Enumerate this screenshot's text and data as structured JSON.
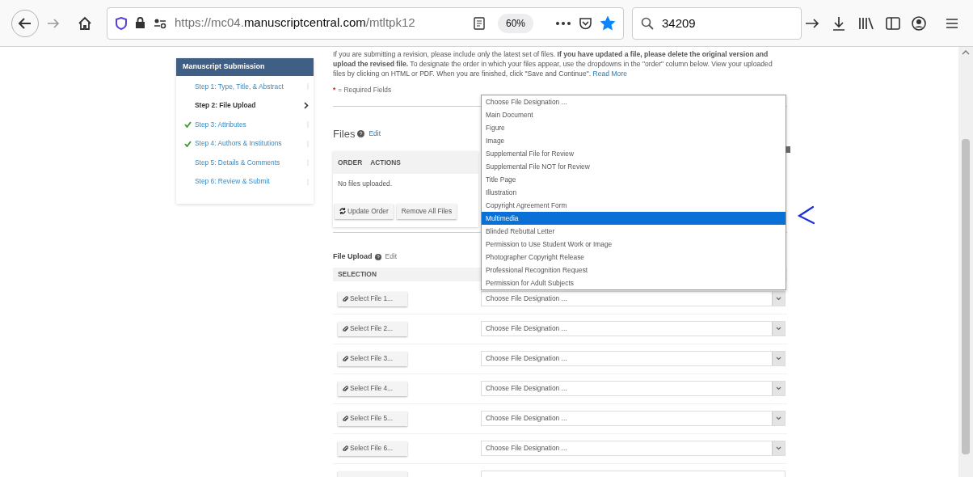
{
  "browser": {
    "url": {
      "prefix": "https://mc04.",
      "domain": "manuscriptcentral.com",
      "path": "/mtltpk12"
    },
    "zoom": "60%",
    "bookmarked": true,
    "search": "34209"
  },
  "sidebar": {
    "title": "Manuscript Submission",
    "steps": [
      {
        "label": "Step 1: Type, Title, & Abstract",
        "done": false,
        "selected": false
      },
      {
        "label": "Step 2: File Upload",
        "done": false,
        "selected": true
      },
      {
        "label": "Step 3: Attributes",
        "done": true,
        "selected": false
      },
      {
        "label": "Step 4: Authors & Institutions",
        "done": true,
        "selected": false
      },
      {
        "label": "Step 5: Details & Comments",
        "done": false,
        "selected": false
      },
      {
        "label": "Step 6: Review & Submit",
        "done": false,
        "selected": false
      }
    ]
  },
  "intro": "If you are submitting a revision, please include only the latest set of files. **If you have updated a file, please delete the original version and upload the revised file.** To designate the order in which your files appear, use the dropdowns in the \"order\" column below. View your uploaded files by clicking on HTML or PDF. When you are finished, click \"Save and Continue\".",
  "read_more": "Read More",
  "required": {
    "mark": "*",
    "label": "= Required Fields"
  },
  "files": {
    "title": "Files",
    "edit": "Edit",
    "columns": [
      "ORDER",
      "ACTIONS"
    ],
    "empty": "No files uploaded.",
    "buttons": [
      "Update Order",
      "Remove All Files"
    ]
  },
  "file_upload": {
    "title": "File Upload",
    "edit": "Edit",
    "column": "SELECTION",
    "rows": [
      {
        "button": "Select File 1...",
        "designation": "Choose File Designation ..."
      },
      {
        "button": "Select File 2...",
        "designation": "Choose File Designation ..."
      },
      {
        "button": "Select File 3...",
        "designation": "Choose File Designation ..."
      },
      {
        "button": "Select File 4...",
        "designation": "Choose File Designation ..."
      },
      {
        "button": "Select File 5...",
        "designation": "Choose File Designation ..."
      },
      {
        "button": "Select File 6...",
        "designation": "Choose File Designation ..."
      }
    ]
  },
  "dropdown": {
    "options": [
      {
        "label": "Choose File Designation ...",
        "selected": false
      },
      {
        "label": "Main Document",
        "selected": false
      },
      {
        "label": "Figure",
        "selected": false
      },
      {
        "label": "Image",
        "selected": false
      },
      {
        "label": "Supplemental File for Review",
        "selected": false
      },
      {
        "label": "Supplemental File NOT for Review",
        "selected": false
      },
      {
        "label": "Title Page",
        "selected": false
      },
      {
        "label": "Illustration",
        "selected": false
      },
      {
        "label": "Copyright Agreement Form",
        "selected": false
      },
      {
        "label": "Multimedia",
        "selected": true
      },
      {
        "label": "Blinded Rebuttal Letter",
        "selected": false
      },
      {
        "label": "Permission to Use Student Work or Image",
        "selected": false
      },
      {
        "label": "Photographer Copyright Release",
        "selected": false
      },
      {
        "label": "Professional Recognition Request",
        "selected": false
      },
      {
        "label": "Permission for Adult Subjects",
        "selected": false
      }
    ]
  }
}
